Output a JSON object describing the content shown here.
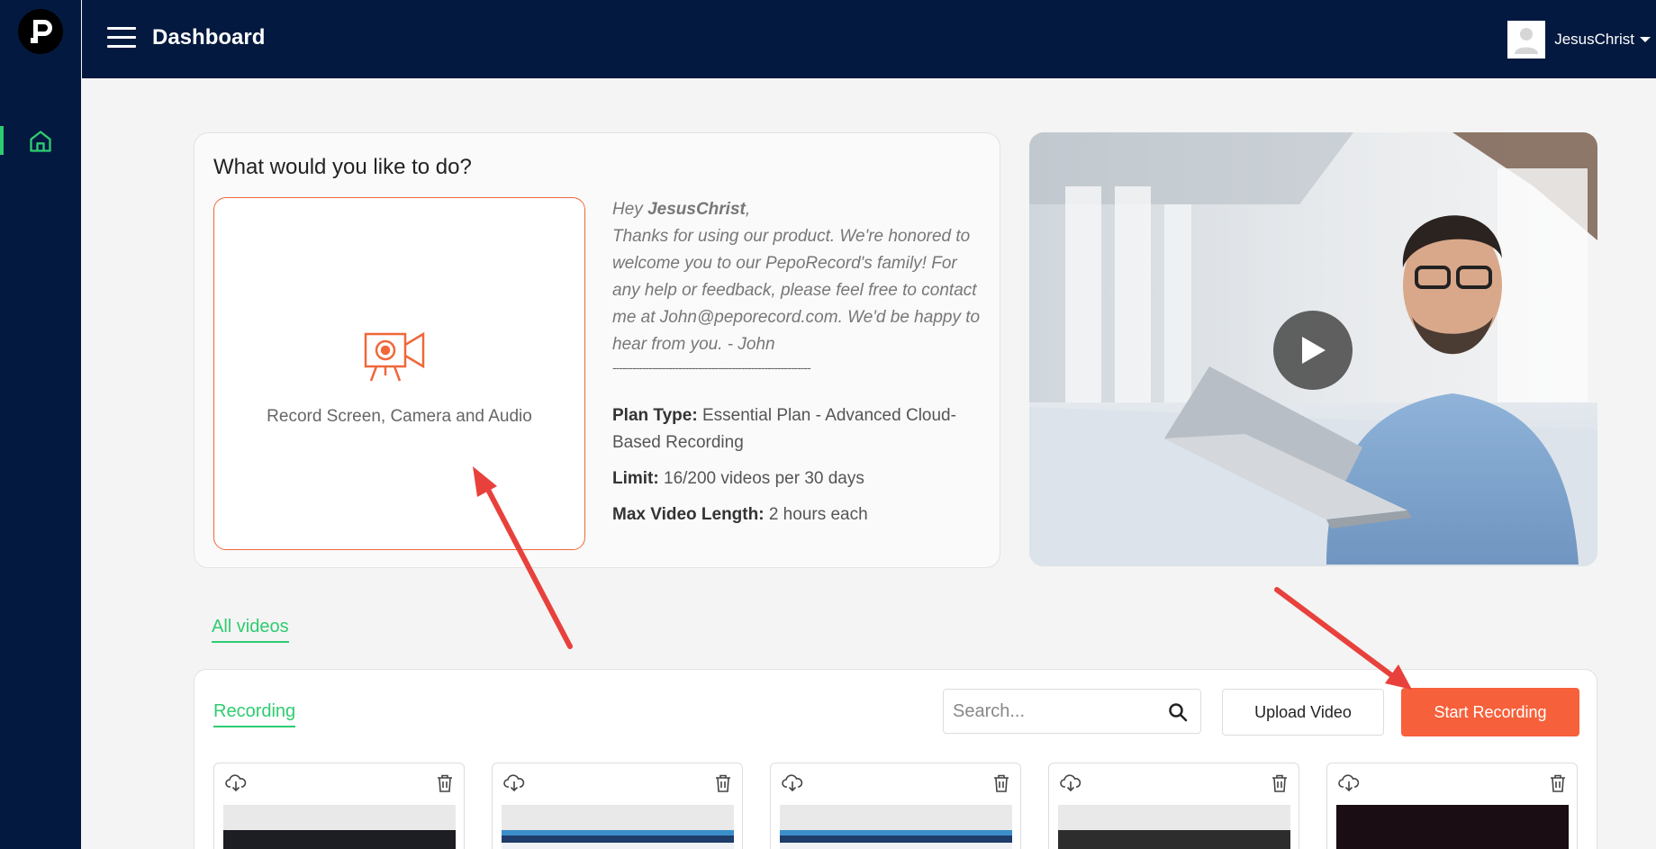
{
  "header": {
    "title": "Dashboard",
    "username": "JesusChrist"
  },
  "intro_card": {
    "title": "What would you like to do?",
    "record_label": "Record Screen, Camera and Audio",
    "greeting_prefix": "Hey ",
    "greeting_name": "JesusChrist",
    "greeting_suffix": ",",
    "message": "Thanks for using our product. We're honored to welcome you to our PepoRecord's family! For any help or feedback, please feel free to contact me at John@peporecord.com. We'd be happy to hear from you. - John",
    "divider": "------------------------------------------------------------",
    "plan_label": "Plan Type:",
    "plan_value": " Essential Plan - Advanced Cloud-Based Recording",
    "limit_label": "Limit:",
    "limit_value": " 16/200 videos per 30 days",
    "maxlen_label": "Max Video Length:",
    "maxlen_value": " 2 hours each"
  },
  "tabs": {
    "all_videos": "All videos",
    "recording": "Recording"
  },
  "toolbar": {
    "search_placeholder": "Search...",
    "upload_label": "Upload Video",
    "start_label": "Start Recording"
  },
  "icons": {
    "logo": "peporecord-logo-icon",
    "home": "home-icon",
    "menu": "hamburger-icon",
    "camera": "video-camera-icon",
    "play": "play-icon",
    "search": "search-icon",
    "download": "cloud-download-icon",
    "delete": "trash-icon"
  },
  "colors": {
    "navy": "#03193f",
    "accent_green": "#2ecc71",
    "accent_orange": "#f6603b",
    "annotation_red": "#e8413c"
  },
  "videos": [
    {
      "preview": "dark-space"
    },
    {
      "preview": "blue-browser"
    },
    {
      "preview": "blue-browser"
    },
    {
      "preview": "dark-terminal"
    },
    {
      "preview": "dark-maroon"
    }
  ]
}
